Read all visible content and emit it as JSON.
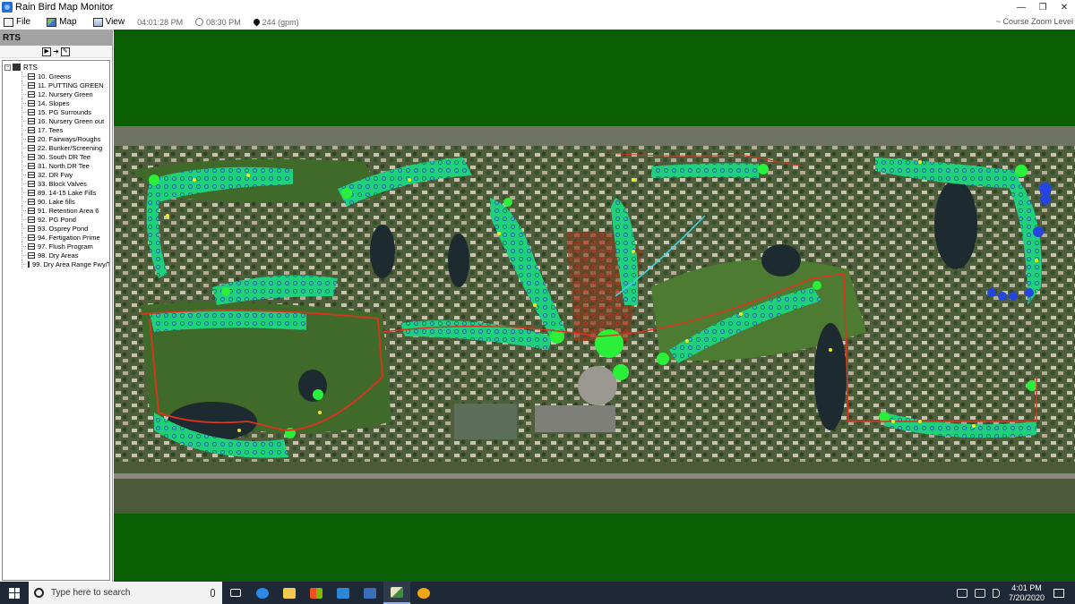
{
  "window": {
    "title": "Rain Bird  Map Monitor",
    "controls": [
      "—",
      "❐",
      "✕"
    ]
  },
  "menu": {
    "file": "File",
    "map": "Map",
    "view": "View"
  },
  "status": {
    "time1": "04:01:28 PM",
    "time2": "08:30 PM",
    "flow": "244 (gpm)",
    "zoom_level": "~ Course Zoom Level"
  },
  "panel": {
    "title": "RTS",
    "tree_root": "RTS",
    "items": [
      "10. Greens",
      "11. PUTTING GREEN",
      "12. Nursery Green",
      "14. Slopes",
      "15. PG Surrounds",
      "16. Nursery Green out",
      "17. Tees",
      "20. Fairways/Roughs",
      "22. Bunker/Screening",
      "30. South DR Tee",
      "31. North DR Tee",
      "32. DR Fwy",
      "33. Block Valves",
      "89. 14-15 Lake Fills",
      "90. Lake fills",
      "91. Retention Area 6",
      "92. PG Pond",
      "93. Osprey Pond",
      "94. Fertigation Prime",
      "97. Flush Program",
      "98. Dry Areas",
      "99. Dry Area Range Fwy/T"
    ]
  },
  "taskbar": {
    "search_placeholder": "Type here to search",
    "time": "4:01 PM",
    "date": "7/20/2020"
  },
  "colors": {
    "map_background": "#0a5f04",
    "fairway_zone": "#1fd17a",
    "valve_red": "#e0311f",
    "taskbar": "#1e2837"
  }
}
